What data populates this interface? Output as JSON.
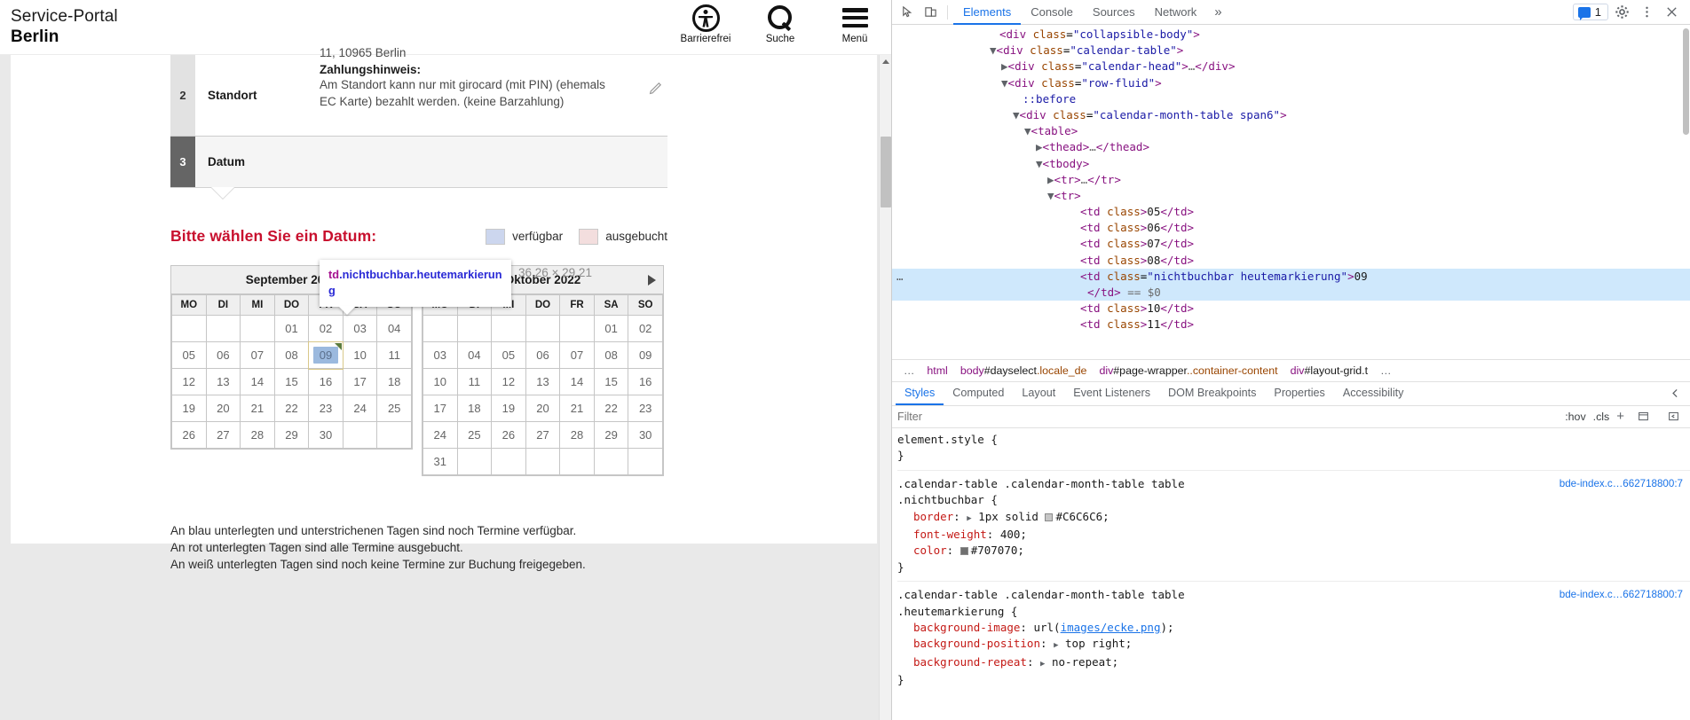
{
  "browser": {
    "site": {
      "line1": "Service-Portal",
      "line2": "Berlin"
    },
    "header_actions": [
      {
        "icon": "accessibility-icon",
        "label": "Barrierefrei"
      },
      {
        "icon": "search-icon",
        "label": "Suche"
      },
      {
        "icon": "hamburger-menu-icon",
        "label": "Menü"
      }
    ],
    "steps": {
      "standort": {
        "number": "2",
        "title": "Standort",
        "address_clipped": "11, 10965 Berlin",
        "hint_title": "Zahlungshinweis:",
        "hint_text_1": "Am Standort kann nur mit girocard (mit PIN) (ehemals",
        "hint_text_2": "EC Karte) bezahlt werden. (keine Barzahlung)",
        "edit_icon": "pencil-icon"
      },
      "datum": {
        "number": "3",
        "title": "Datum"
      }
    },
    "section_heading": "Bitte wählen Sie ein Datum:",
    "legend": [
      {
        "swatch": "#ccd6ee",
        "label": "verfügbar"
      },
      {
        "swatch": "#f3dede",
        "label": "ausgebucht"
      }
    ],
    "weekday_headers": [
      "MO",
      "DI",
      "MI",
      "DO",
      "FR",
      "SA",
      "SO"
    ],
    "calendars": [
      {
        "title": "September 2022",
        "nav_next": false,
        "nav_prev": false,
        "weeks": [
          [
            {
              "label": "",
              "state": "empty"
            },
            {
              "label": "",
              "state": "empty"
            },
            {
              "label": "",
              "state": "empty"
            },
            {
              "label": "01",
              "state": "nichtbuchbar"
            },
            {
              "label": "02",
              "state": "nichtbuchbar"
            },
            {
              "label": "03",
              "state": "nichtbuchbar"
            },
            {
              "label": "04",
              "state": "nichtbuchbar"
            }
          ],
          [
            {
              "label": "05",
              "state": "nichtbuchbar"
            },
            {
              "label": "06",
              "state": "nichtbuchbar"
            },
            {
              "label": "07",
              "state": "nichtbuchbar"
            },
            {
              "label": "08",
              "state": "nichtbuchbar"
            },
            {
              "label": "09",
              "state": "today"
            },
            {
              "label": "10",
              "state": "nichtbuchbar"
            },
            {
              "label": "11",
              "state": "nichtbuchbar"
            }
          ],
          [
            {
              "label": "12",
              "state": "ausgebucht"
            },
            {
              "label": "13",
              "state": "ausgebucht"
            },
            {
              "label": "14",
              "state": "ausgebucht"
            },
            {
              "label": "15",
              "state": "ausgebucht"
            },
            {
              "label": "16",
              "state": "ausgebucht"
            },
            {
              "label": "17",
              "state": "nichtbuchbar"
            },
            {
              "label": "18",
              "state": "nichtbuchbar"
            }
          ],
          [
            {
              "label": "19",
              "state": "ausgebucht"
            },
            {
              "label": "20",
              "state": "ausgebucht"
            },
            {
              "label": "21",
              "state": "ausgebucht"
            },
            {
              "label": "22",
              "state": "ausgebucht"
            },
            {
              "label": "23",
              "state": "nichtbuchbar"
            },
            {
              "label": "24",
              "state": "nichtbuchbar"
            },
            {
              "label": "25",
              "state": "nichtbuchbar"
            }
          ],
          [
            {
              "label": "26",
              "state": "ausgebucht"
            },
            {
              "label": "27",
              "state": "ausgebucht"
            },
            {
              "label": "28",
              "state": "ausgebucht"
            },
            {
              "label": "29",
              "state": "ausgebucht"
            },
            {
              "label": "30",
              "state": "ausgebucht"
            },
            {
              "label": "",
              "state": "leer"
            },
            {
              "label": "",
              "state": "leer"
            }
          ]
        ]
      },
      {
        "title": "Oktober 2022",
        "nav_next": true,
        "nav_prev": false,
        "weeks": [
          [
            {
              "label": "",
              "state": "empty"
            },
            {
              "label": "",
              "state": "empty"
            },
            {
              "label": "",
              "state": "empty"
            },
            {
              "label": "",
              "state": "empty"
            },
            {
              "label": "",
              "state": "empty"
            },
            {
              "label": "01",
              "state": "nichtbuchbar"
            },
            {
              "label": "02",
              "state": "nichtbuchbar"
            }
          ],
          [
            {
              "label": "03",
              "state": "nichtbuchbar"
            },
            {
              "label": "04",
              "state": "ausgebucht"
            },
            {
              "label": "05",
              "state": "ausgebucht"
            },
            {
              "label": "06",
              "state": "ausgebucht"
            },
            {
              "label": "07",
              "state": "ausgebucht"
            },
            {
              "label": "08",
              "state": "nichtbuchbar"
            },
            {
              "label": "09",
              "state": "nichtbuchbar"
            }
          ],
          [
            {
              "label": "10",
              "state": "ausgebucht"
            },
            {
              "label": "11",
              "state": "ausgebucht"
            },
            {
              "label": "12",
              "state": "ausgebucht"
            },
            {
              "label": "13",
              "state": "ausgebucht"
            },
            {
              "label": "14",
              "state": "ausgebucht"
            },
            {
              "label": "15",
              "state": "nichtbuchbar"
            },
            {
              "label": "16",
              "state": "nichtbuchbar"
            }
          ],
          [
            {
              "label": "17",
              "state": "ausgebucht"
            },
            {
              "label": "18",
              "state": "ausgebucht"
            },
            {
              "label": "19",
              "state": "ausgebucht"
            },
            {
              "label": "20",
              "state": "ausgebucht"
            },
            {
              "label": "21",
              "state": "ausgebucht"
            },
            {
              "label": "22",
              "state": "nichtbuchbar"
            },
            {
              "label": "23",
              "state": "nichtbuchbar"
            }
          ],
          [
            {
              "label": "24",
              "state": "ausgebucht"
            },
            {
              "label": "25",
              "state": "ausgebucht"
            },
            {
              "label": "26",
              "state": "ausgebucht"
            },
            {
              "label": "27",
              "state": "ausgebucht"
            },
            {
              "label": "28",
              "state": "ausgebucht"
            },
            {
              "label": "29",
              "state": "nichtbuchbar"
            },
            {
              "label": "30",
              "state": "nichtbuchbar"
            }
          ],
          [
            {
              "label": "31",
              "state": "ausgebucht"
            },
            {
              "label": "",
              "state": "leer"
            },
            {
              "label": "",
              "state": "leer"
            },
            {
              "label": "",
              "state": "leer"
            },
            {
              "label": "",
              "state": "leer"
            },
            {
              "label": "",
              "state": "leer"
            },
            {
              "label": "",
              "state": "leer"
            }
          ]
        ]
      }
    ],
    "inspector_tooltip": {
      "tag": "td",
      "classes": ".nichtbuchbar.heutemarkierung",
      "dimensions": "36.26 × 29.21"
    },
    "footer_notes": [
      "An blau unterlegten und unterstrichenen Tagen sind noch Termine verfügbar.",
      "An rot unterlegten Tagen sind alle Termine ausgebucht.",
      "An weiß unterlegten Tagen sind noch keine Termine zur Buchung freigegeben."
    ]
  },
  "devtools": {
    "toolbar": {
      "inspect_icon": "inspect-element-icon",
      "device_icon": "device-toolbar-icon",
      "tabs": [
        {
          "label": "Elements",
          "active": true
        },
        {
          "label": "Console",
          "active": false
        },
        {
          "label": "Sources",
          "active": false
        },
        {
          "label": "Network",
          "active": false
        }
      ],
      "more_tabs": "»",
      "message_count": "1",
      "settings_icon": "gear-icon",
      "kebab_icon": "more-vertical-icon",
      "close_icon": "close-icon"
    },
    "dom_lines": [
      {
        "indent": 9,
        "html": "<span class=\"pun\">&lt;</span><span class=\"tg\">div</span> <span class=\"at\">class</span>=<span class=\"av\">\"collapsible-body\"</span><span class=\"pun\">&gt;</span>",
        "clipped": true
      },
      {
        "indent": 9,
        "arrow": "down",
        "html": "<span class=\"pun\">&lt;</span><span class=\"tg\">div</span> <span class=\"at\">class</span>=<span class=\"av\">\"calendar-table\"</span><span class=\"pun\">&gt;</span>"
      },
      {
        "indent": 10,
        "arrow": "right",
        "html": "<span class=\"pun\">&lt;</span><span class=\"tg\">div</span> <span class=\"at\">class</span>=<span class=\"av\">\"calendar-head\"</span><span class=\"pun\">&gt;</span><span class=\"gray\">…</span><span class=\"pun\">&lt;/</span><span class=\"tg\">div</span><span class=\"pun\">&gt;</span>"
      },
      {
        "indent": 10,
        "arrow": "down",
        "html": "<span class=\"pun\">&lt;</span><span class=\"tg\">div</span> <span class=\"at\">class</span>=<span class=\"av\">\"row-fluid\"</span><span class=\"pun\">&gt;</span>"
      },
      {
        "indent": 11,
        "html": "<span class=\"av\">::before</span>"
      },
      {
        "indent": 11,
        "arrow": "down",
        "html": "<span class=\"pun\">&lt;</span><span class=\"tg\">div</span> <span class=\"at\">class</span>=<span class=\"av\">\"calendar-month-table span6\"</span><span class=\"pun\">&gt;</span>"
      },
      {
        "indent": 12,
        "arrow": "down",
        "html": "<span class=\"pun\">&lt;</span><span class=\"tg\">table</span><span class=\"pun\">&gt;</span>"
      },
      {
        "indent": 13,
        "arrow": "right",
        "html": "<span class=\"pun\">&lt;</span><span class=\"tg\">thead</span><span class=\"pun\">&gt;</span><span class=\"gray\">…</span><span class=\"pun\">&lt;/</span><span class=\"tg\">thead</span><span class=\"pun\">&gt;</span>"
      },
      {
        "indent": 13,
        "arrow": "down",
        "html": "<span class=\"pun\">&lt;</span><span class=\"tg\">tbody</span><span class=\"pun\">&gt;</span>"
      },
      {
        "indent": 14,
        "arrow": "right",
        "html": "<span class=\"pun\">&lt;</span><span class=\"tg\">tr</span><span class=\"pun\">&gt;</span><span class=\"gray\">…</span><span class=\"pun\">&lt;/</span><span class=\"tg\">tr</span><span class=\"pun\">&gt;</span>"
      },
      {
        "indent": 14,
        "arrow": "down",
        "html": "<span class=\"pun\">&lt;</span><span class=\"tg\">tr</span><span class=\"pun\">&gt;</span>"
      },
      {
        "indent": 16,
        "html": "<span class=\"pun\">&lt;</span><span class=\"tg\">td</span> <span class=\"at\">class</span><span class=\"pun\">&gt;</span><span class=\"txt\">05</span><span class=\"pun\">&lt;/</span><span class=\"tg\">td</span><span class=\"pun\">&gt;</span>"
      },
      {
        "indent": 16,
        "html": "<span class=\"pun\">&lt;</span><span class=\"tg\">td</span> <span class=\"at\">class</span><span class=\"pun\">&gt;</span><span class=\"txt\">06</span><span class=\"pun\">&lt;/</span><span class=\"tg\">td</span><span class=\"pun\">&gt;</span>"
      },
      {
        "indent": 16,
        "html": "<span class=\"pun\">&lt;</span><span class=\"tg\">td</span> <span class=\"at\">class</span><span class=\"pun\">&gt;</span><span class=\"txt\">07</span><span class=\"pun\">&lt;/</span><span class=\"tg\">td</span><span class=\"pun\">&gt;</span>"
      },
      {
        "indent": 16,
        "html": "<span class=\"pun\">&lt;</span><span class=\"tg\">td</span> <span class=\"at\">class</span><span class=\"pun\">&gt;</span><span class=\"txt\">08</span><span class=\"pun\">&lt;/</span><span class=\"tg\">td</span><span class=\"pun\">&gt;</span>"
      },
      {
        "indent": 16,
        "selected": true,
        "html": "<span class=\"pun\">&lt;</span><span class=\"tg\">td</span> <span class=\"at\">class</span>=<span class=\"av\">\"nichtbuchbar heutemarkierung\"</span><span class=\"pun\">&gt;</span><span class=\"txt\">09</span>"
      },
      {
        "indent": 16,
        "selected": true,
        "html": "<span class=\"pun\">&lt;/</span><span class=\"tg\">td</span><span class=\"pun\">&gt;</span> <span class=\"dollar\">== $0</span>",
        "indentExtra": true
      },
      {
        "indent": 16,
        "html": "<span class=\"pun\">&lt;</span><span class=\"tg\">td</span> <span class=\"at\">class</span><span class=\"pun\">&gt;</span><span class=\"txt\">10</span><span class=\"pun\">&lt;/</span><span class=\"tg\">td</span><span class=\"pun\">&gt;</span>"
      },
      {
        "indent": 16,
        "html": "<span class=\"pun\">&lt;</span><span class=\"tg\">td</span> <span class=\"at\">class</span><span class=\"pun\">&gt;</span><span class=\"txt\">11</span><span class=\"pun\">&lt;/</span><span class=\"tg\">td</span><span class=\"pun\">&gt;</span>"
      }
    ],
    "breadcrumb": [
      {
        "text": "…",
        "type": "dots"
      },
      {
        "text": "html",
        "type": "tag"
      },
      {
        "text": "body",
        "id": "#dayselect",
        "cls": ".locale_de",
        "type": "el"
      },
      {
        "text": "div",
        "id": "#page-wrapper",
        "cls": "..container-content",
        "type": "el"
      },
      {
        "text": "div",
        "id": "#layout-grid.t",
        "cls": "",
        "type": "el"
      },
      {
        "text": "…",
        "type": "dots"
      }
    ],
    "sub_tabs": [
      {
        "label": "Styles",
        "active": true
      },
      {
        "label": "Computed",
        "active": false
      },
      {
        "label": "Layout",
        "active": false
      },
      {
        "label": "Event Listeners",
        "active": false
      },
      {
        "label": "DOM Breakpoints",
        "active": false
      },
      {
        "label": "Properties",
        "active": false
      },
      {
        "label": "Accessibility",
        "active": false
      }
    ],
    "filter_placeholder": "Filter",
    "filter_value": "",
    "hov_label": ":hov",
    "cls_label": ".cls",
    "plus_label": "+",
    "css_rules": [
      {
        "selector": "element.style {",
        "source": "",
        "declarations": [],
        "close": "}"
      },
      {
        "selector": ".calendar-table .calendar-month-table table",
        "selector_line2": ".nichtbuchbar {",
        "source": "bde-index.c…662718800:7",
        "declarations": [
          {
            "prop": "border",
            "value": "1px solid #C6C6C6;",
            "swatch": "#C6C6C6",
            "expandable": true
          },
          {
            "prop": "font-weight",
            "value": "400;"
          },
          {
            "prop": "color",
            "value": "#707070;",
            "swatch": "#707070"
          }
        ],
        "close": "}"
      },
      {
        "selector": ".calendar-table .calendar-month-table table",
        "selector_line2": ".heutemarkierung {",
        "source": "bde-index.c…662718800:7",
        "declarations": [
          {
            "prop": "background-image",
            "value": "url(images/ecke.png);",
            "link": "images/ecke.png"
          },
          {
            "prop": "background-position",
            "value": "top right;",
            "expandable": true
          },
          {
            "prop": "background-repeat",
            "value": "no-repeat;",
            "expandable": true
          }
        ],
        "close": "}"
      }
    ]
  }
}
